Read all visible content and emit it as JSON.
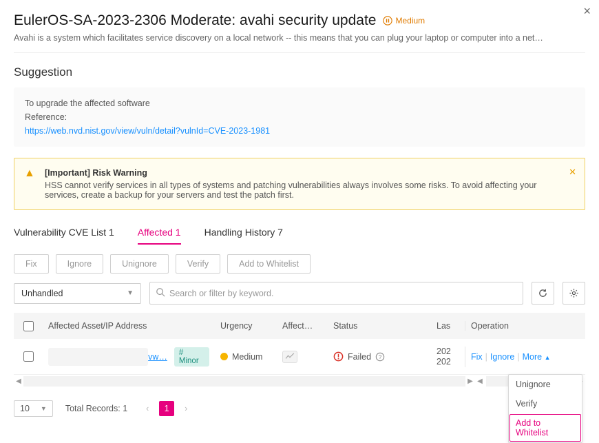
{
  "close_label": "×",
  "header": {
    "title": "EulerOS-SA-2023-2306 Moderate: avahi security update",
    "severity": "Medium",
    "description": "Avahi is a system which facilitates service discovery on a local network -- this means that you can plug your laptop or computer into a net…"
  },
  "suggestion": {
    "heading": "Suggestion",
    "upgrade_text": "To upgrade the affected software",
    "reference_label": "Reference:",
    "reference_url": "https://web.nvd.nist.gov/view/vuln/detail?vulnId=CVE-2023-1981"
  },
  "warning": {
    "title": "[Important] Risk Warning",
    "body": "HSS cannot verify services in all types of systems and patching vulnerabilities always involves some risks. To avoid affecting your services, create a backup for your servers and test the patch first."
  },
  "tabs": [
    {
      "label": "Vulnerability CVE List 1",
      "active": false
    },
    {
      "label": "Affected 1",
      "active": true
    },
    {
      "label": "Handling History 7",
      "active": false
    }
  ],
  "actions": {
    "fix": "Fix",
    "ignore": "Ignore",
    "unignore": "Unignore",
    "verify": "Verify",
    "add_whitelist": "Add to Whitelist"
  },
  "filter": {
    "status_value": "Unhandled",
    "search_placeholder": "Search or filter by keyword."
  },
  "table": {
    "cols": {
      "asset": "Affected Asset/IP Address",
      "urgency": "Urgency",
      "affect": "Affect…",
      "status": "Status",
      "last": "Las",
      "operation": "Operation"
    },
    "row": {
      "asset_link_fragment": "vw…",
      "minor_tag": "# Minor",
      "urgency": "Medium",
      "status_text": "Failed",
      "last1": "202",
      "last2": "202",
      "op_fix": "Fix",
      "op_ignore": "Ignore",
      "op_more": "More",
      "more_menu": {
        "unignore": "Unignore",
        "verify": "Verify",
        "add_whitelist": "Add to Whitelist"
      }
    }
  },
  "pager": {
    "page_size": "10",
    "total_label": "Total Records: 1",
    "current": "1"
  }
}
